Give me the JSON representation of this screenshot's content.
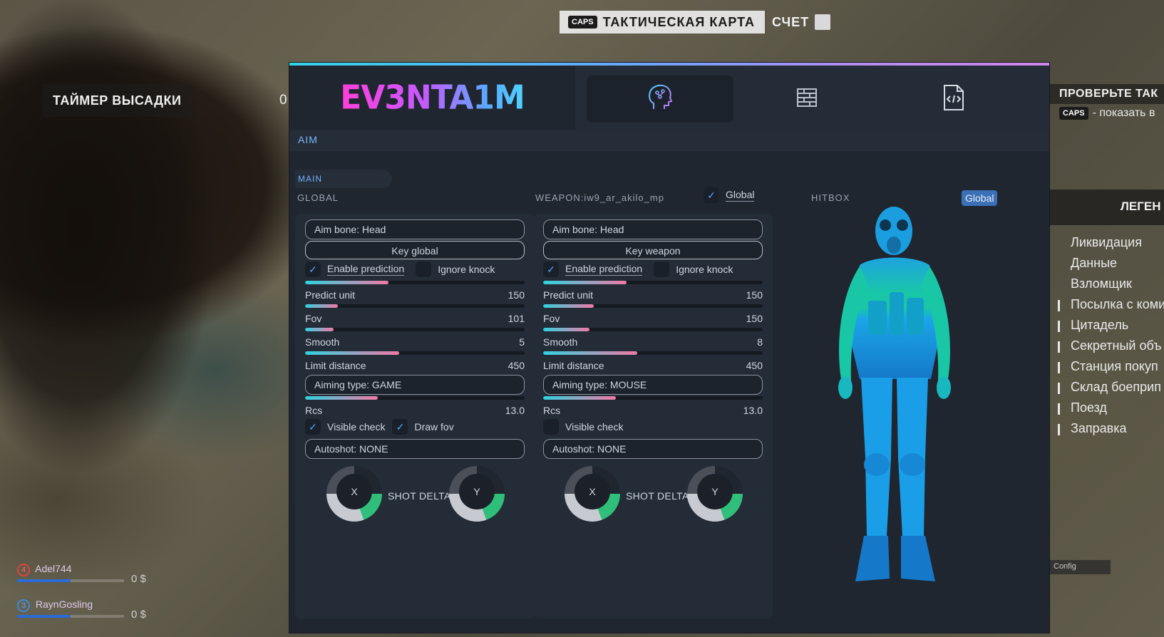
{
  "hud": {
    "map_key": "CAPS",
    "map_label": "ТАКТИЧЕСКАЯ КАРТА",
    "score_label": "СЧЕТ",
    "drop_timer": "ТАЙМЕР ВЫСАДКИ",
    "drop_timer_value": "0",
    "right_title": "ПРОВЕРЬТЕ ТАК",
    "right_hint_key": "CAPS",
    "right_hint_text": "- показать в",
    "legend_title": "ЛЕГЕН",
    "legend_items": [
      "Ликвидация",
      "Данные",
      "Взломщик",
      "Посылка с коми",
      "Цитадель",
      "Секретный объ",
      "Станция покуп",
      "Склад боеприп",
      "Поезд",
      "Заправка"
    ],
    "team": [
      {
        "num": "4",
        "name": "Adel744",
        "money": "0 $"
      },
      {
        "num": "3",
        "name": "RaynGosling",
        "money": "0 $"
      }
    ],
    "config_label": "Config"
  },
  "panel": {
    "logo": "EV3NTA1M",
    "tabs": [
      "aim-tab",
      "misc-tab",
      "config-tab"
    ],
    "breadcrumb": "AIM",
    "subtab": "MAIN",
    "hitbox_label": "HITBOX",
    "hitbox_global_badge": "Global",
    "accent": "#5aa3ff"
  },
  "global": {
    "title": "GLOBAL",
    "aim_bone": "Aim bone: Head",
    "key": "Key global",
    "enable_prediction": "Enable prediction",
    "ignore_knock": "Ignore knock",
    "sliders": [
      {
        "label": "Predict unit",
        "value": "150",
        "fill": 0.38
      },
      {
        "label": "Fov",
        "value": "101",
        "fill": 0.15
      },
      {
        "label": "Smooth",
        "value": "5",
        "fill": 0.13
      },
      {
        "label": "Limit distance",
        "value": "450",
        "fill": 0.43
      }
    ],
    "aiming_type": "Aiming type: GAME",
    "rcs": {
      "label": "Rcs",
      "value": "13.0",
      "fill": 0.33
    },
    "visible_check": "Visible check",
    "draw_fov": "Draw fov",
    "autoshot": "Autoshot: NONE",
    "shot_delta": "SHOT DELTA",
    "x_label": "X",
    "y_label": "Y"
  },
  "weapon": {
    "title": "WEAPON:iw9_ar_akilo_mp",
    "global_toggle": "Global",
    "aim_bone": "Aim bone: Head",
    "key": "Key weapon",
    "enable_prediction": "Enable prediction",
    "ignore_knock": "Ignore knock",
    "sliders": [
      {
        "label": "Predict unit",
        "value": "150",
        "fill": 0.38
      },
      {
        "label": "Fov",
        "value": "150",
        "fill": 0.23
      },
      {
        "label": "Smooth",
        "value": "8",
        "fill": 0.21
      },
      {
        "label": "Limit distance",
        "value": "450",
        "fill": 0.43
      }
    ],
    "aiming_type": "Aiming type: MOUSE",
    "rcs": {
      "label": "Rcs",
      "value": "13.0",
      "fill": 0.33
    },
    "visible_check": "Visible check",
    "autoshot": "Autoshot: NONE",
    "shot_delta": "SHOT DELTA",
    "x_label": "X",
    "y_label": "Y"
  }
}
